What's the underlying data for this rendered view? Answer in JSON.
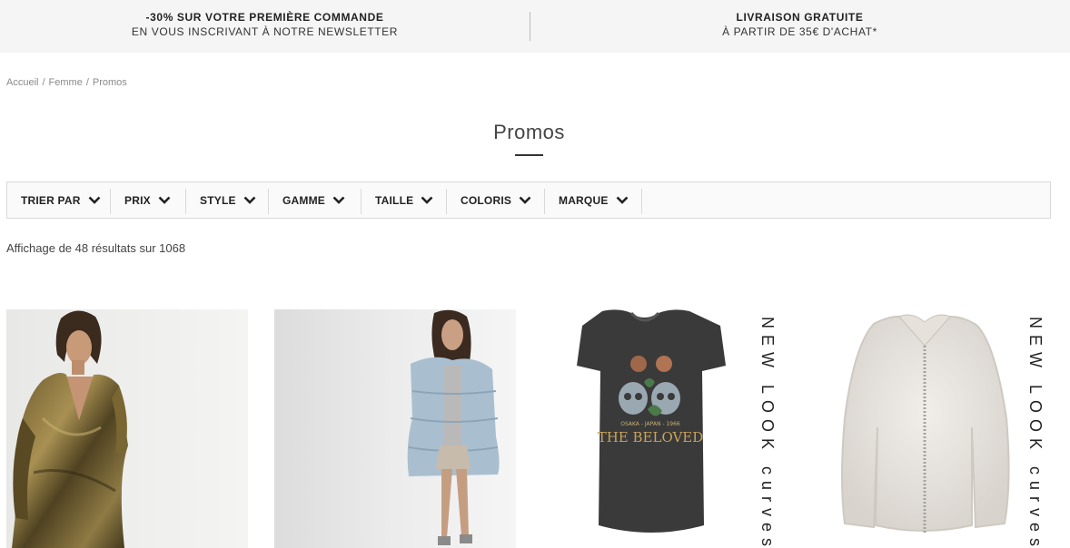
{
  "promo": {
    "left_title": "-30% SUR VOTRE PREMIÈRE COMMANDE",
    "left_subtitle": "EN VOUS INSCRIVANT À NOTRE NEWSLETTER",
    "right_title": "LIVRAISON GRATUITE",
    "right_subtitle": "À PARTIR DE 35€ D'ACHAT*"
  },
  "breadcrumb": [
    "Accueil",
    "Femme",
    "Promos"
  ],
  "breadcrumb_sep": "/",
  "page_title": "Promos",
  "filters": [
    "TRIER PAR",
    "PRIX",
    "STYLE",
    "GAMME",
    "TAILLE",
    "COLORIS",
    "MARQUE"
  ],
  "results_text": "Affichage de 48 résultats sur 1068",
  "products": [
    {
      "image": "metallic-wrap-dress",
      "brand_text": ""
    },
    {
      "image": "blue-puffer-coat",
      "brand_text": ""
    },
    {
      "image": "the-beloved-tshirt",
      "brand_text": "NEW LOOK curves",
      "print_text": "THE BELOVED",
      "print_sub": "OSAKA - JAPAN - 1966"
    },
    {
      "image": "faux-fur-jacket",
      "brand_text": "NEW LOOK curves"
    }
  ],
  "colors": {
    "promo_bg": "#f5f5f5",
    "filter_bg": "#fafafa",
    "text": "#333333"
  }
}
